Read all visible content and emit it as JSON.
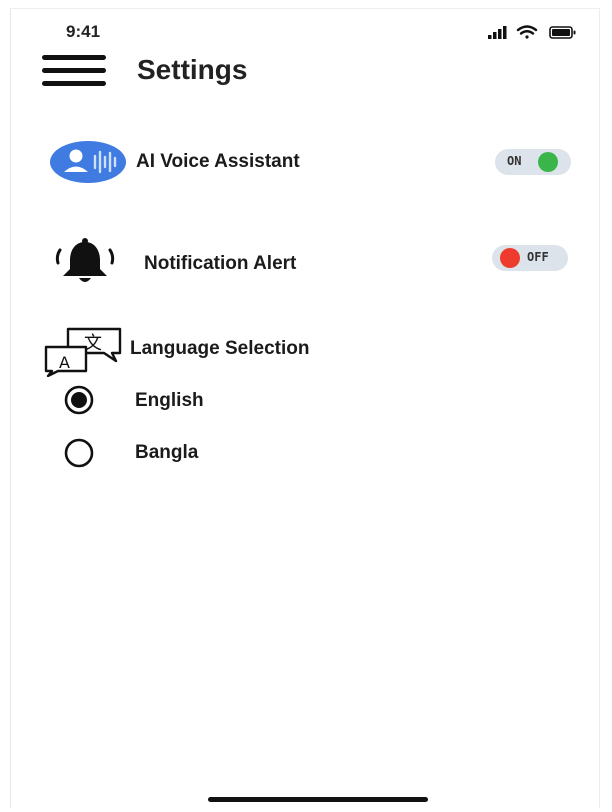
{
  "status_bar": {
    "time": "9:41"
  },
  "header": {
    "title": "Settings",
    "menu_icon": "hamburger-menu-icon"
  },
  "settings": {
    "voice_assistant": {
      "label": "AI Voice Assistant",
      "icon": "voice-assistant-icon",
      "toggle_text": "ON",
      "state": "on",
      "color": "#3ab54a"
    },
    "notification_alert": {
      "label": "Notification Alert",
      "icon": "bell-icon",
      "toggle_text": "OFF",
      "state": "off",
      "color": "#ef3b2d"
    }
  },
  "language": {
    "label": "Language Selection",
    "icon": "translate-icon",
    "options": [
      {
        "label": "English",
        "selected": true
      },
      {
        "label": "Bangla",
        "selected": false
      }
    ]
  },
  "colors": {
    "accent_blue": "#3f7be0",
    "toggle_track": "#dde3ea",
    "on_green": "#3ab54a",
    "off_red": "#ef3b2d"
  }
}
